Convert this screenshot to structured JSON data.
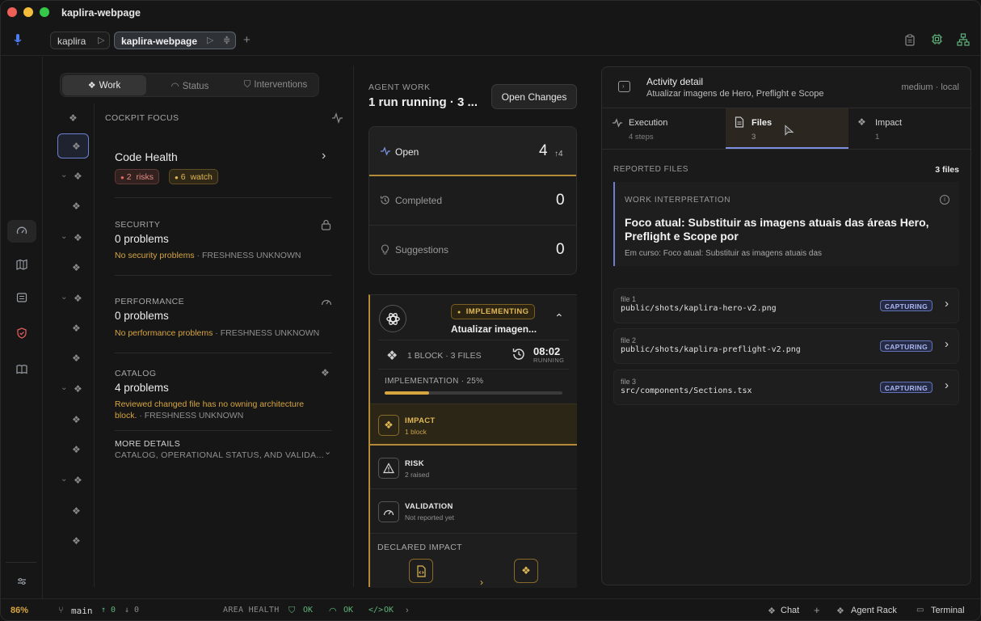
{
  "window": {
    "title": "kaplira-webpage",
    "tabs": [
      {
        "label": "kaplira"
      },
      {
        "label": "kaplira-webpage"
      }
    ]
  },
  "colors": {
    "accent": "#d6a540",
    "bg": "#161616",
    "capturing": "#aab6ef",
    "ok": "#5fb37a"
  },
  "rail": {
    "zoom": "86%"
  },
  "left": {
    "segments": [
      "Work",
      "Status",
      "Interventions"
    ],
    "focus_title": "COCKPIT FOCUS",
    "code_health": {
      "title": "Code Health",
      "risks_count": "2",
      "risks_label": "risks",
      "watch_count": "6",
      "watch_label": "watch"
    },
    "security": {
      "title": "SECURITY",
      "value": "0 problems",
      "note": "No security problems",
      "fresh": " · FRESHNESS UNKNOWN"
    },
    "performance": {
      "title": "PERFORMANCE",
      "value": "0 problems",
      "note": "No performance problems",
      "fresh": " · FRESHNESS UNKNOWN"
    },
    "catalog": {
      "title": "CATALOG",
      "value": "4 problems",
      "note": "Reviewed changed file has no owning architecture block.",
      "fresh": " · FRESHNESS UNKNOWN"
    },
    "more": {
      "title": "MORE DETAILS",
      "sub": "CATALOG, OPERATIONAL STATUS, AND VALIDA..."
    }
  },
  "center": {
    "label": "AGENT WORK",
    "headline": "1 run running · 3 ...",
    "open_changes": "Open Changes",
    "counts": [
      {
        "label": "Open",
        "value": "4",
        "delta": "↑4"
      },
      {
        "label": "Completed",
        "value": "0"
      },
      {
        "label": "Suggestions",
        "value": "0"
      }
    ],
    "run": {
      "status": "IMPLEMENTING",
      "title": "Atualizar imagen...",
      "blocks": "1 BLOCK · 3 FILES",
      "time": "08:02",
      "time_label": "RUNNING",
      "progress_label": "IMPLEMENTATION · 25%",
      "progress": 0.25,
      "items": [
        {
          "title": "IMPACT",
          "sub": "1 block"
        },
        {
          "title": "RISK",
          "sub": "2 raised"
        },
        {
          "title": "VALIDATION",
          "sub": "Not reported yet"
        }
      ],
      "declared": "DECLARED IMPACT"
    }
  },
  "right": {
    "title": "Activity detail",
    "subtitle": "Atualizar imagens de Hero, Preflight e Scope",
    "meta": "medium · local",
    "tabs": [
      {
        "label": "Execution",
        "sub": "4 steps"
      },
      {
        "label": "Files",
        "sub": "3"
      },
      {
        "label": "Impact",
        "sub": "1"
      }
    ],
    "reported": "REPORTED FILES",
    "reported_count": "3 files",
    "interp_label": "WORK INTERPRETATION",
    "interp_title": "Foco atual: Substituir as imagens atuais das áreas Hero, Preflight e Scope por",
    "interp_sub": "Em curso: Foco atual: Substituir as imagens atuais das",
    "files": [
      {
        "label": "file 1",
        "path": "public/shots/kaplira-hero-v2.png",
        "status": "CAPTURING"
      },
      {
        "label": "file 2",
        "path": "public/shots/kaplira-preflight-v2.png",
        "status": "CAPTURING"
      },
      {
        "label": "file 3",
        "path": "src/components/Sections.tsx",
        "status": "CAPTURING"
      }
    ]
  },
  "statusbar": {
    "branch": "main",
    "ahead": "↑ 0",
    "behind": "↓ 0",
    "area_health": "AREA HEALTH",
    "ok1": "OK",
    "ok2": "OK",
    "ok3": "OK",
    "chat": "Chat",
    "agent_rack": "Agent Rack",
    "terminal": "Terminal"
  }
}
